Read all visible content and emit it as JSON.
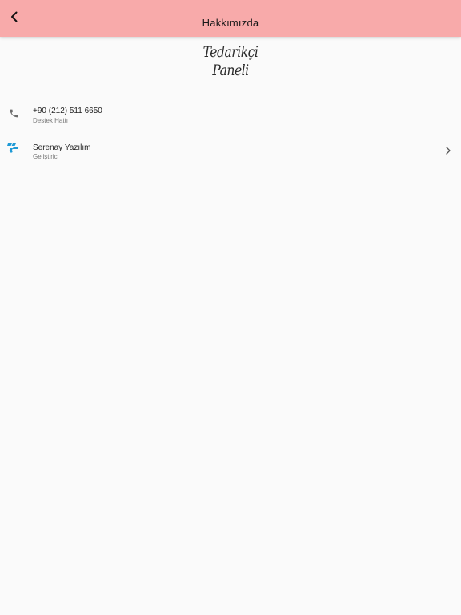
{
  "app_bar": {
    "title": "Hakkımızda",
    "back_icon": "chevron-left-icon",
    "background_color": "#f8aaaa"
  },
  "logo": {
    "line1": "Tedarikçi",
    "line2": "Paneli"
  },
  "contacts": [
    {
      "icon": "phone-icon",
      "title": "+90 (212) 511 6650",
      "subtitle": "Destek Hattı"
    },
    {
      "icon": "developer-logo-icon",
      "icon_color": "#1e9ad6",
      "title": "Serenay Yazılım",
      "subtitle": "Geliştirici",
      "trailing_icon": "chevron-right-icon"
    }
  ]
}
